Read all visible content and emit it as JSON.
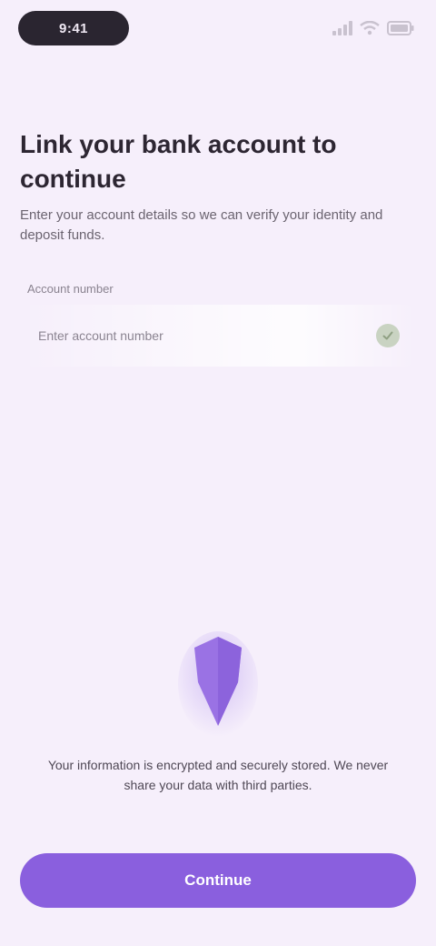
{
  "status_bar": {
    "time": "9:41",
    "icons": [
      "signal-icon",
      "wifi-icon",
      "battery-icon"
    ]
  },
  "header": {
    "title": "Link your bank account to continue",
    "subtitle": "Enter your account details so we can verify your identity and deposit funds."
  },
  "form": {
    "account_label": "Account number",
    "account_placeholder": "Enter account number"
  },
  "footer": {
    "notice": "Your information is encrypted and securely stored. We never share your data with third parties.",
    "cta_label": "Continue"
  },
  "colors": {
    "background": "#f6effb",
    "accent": "#8a5fde",
    "check": "#c9d3c2"
  }
}
